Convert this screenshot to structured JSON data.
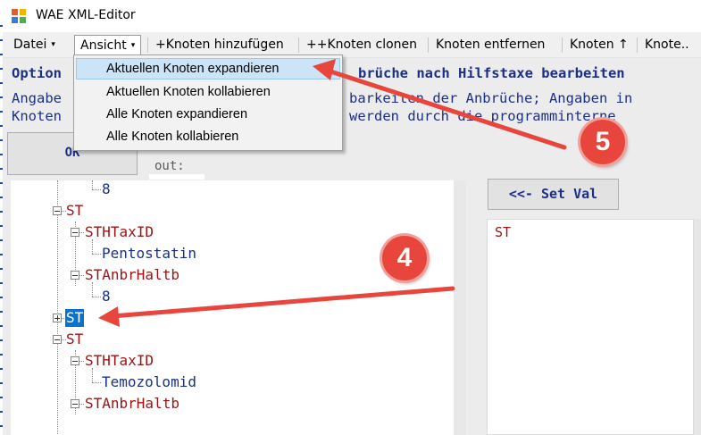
{
  "window": {
    "title": "WAE XML-Editor",
    "icon": "app-icon"
  },
  "menubar": {
    "datei": "Datei",
    "ansicht": "Ansicht",
    "add_node": "+Knoten hinzufügen",
    "clone_node": "++Knoten clonen",
    "remove_node": "Knoten entfernen",
    "node_up": "Knoten ↑",
    "node_down": "Knote.."
  },
  "dropdown": {
    "items": [
      "Aktuellen Knoten expandieren",
      "Aktuellen Knoten kollabieren",
      "Alle Knoten expandieren",
      "Alle Knoten kollabieren"
    ],
    "highlighted_index": 0
  },
  "description": {
    "line1a": "Option",
    "line1b": "brüche nach Hilfstaxe bearbeiten",
    "line2a": "Angabe",
    "line2b": "barkeiten der Anbrüche; Angaben in",
    "line3a": "Knoten",
    "line3b": "werden durch die programminterne"
  },
  "ok_button": "OK",
  "out_label": "out:",
  "tree": {
    "nodes": [
      {
        "text": "8"
      },
      {
        "text": "ST"
      },
      {
        "text": "STHTaxID"
      },
      {
        "text": "Pentostatin"
      },
      {
        "text": "STAnbrHaltb"
      },
      {
        "text": "8"
      },
      {
        "text": "ST",
        "selected": true
      },
      {
        "text": "ST"
      },
      {
        "text": "STHTaxID"
      },
      {
        "text": "Temozolomid"
      },
      {
        "text": "STAnbrHaltb"
      }
    ]
  },
  "setval_button": "<<- Set Val",
  "value_text": "ST",
  "annotations": {
    "badge4": "4",
    "badge5": "5",
    "color": "#e8453c"
  }
}
